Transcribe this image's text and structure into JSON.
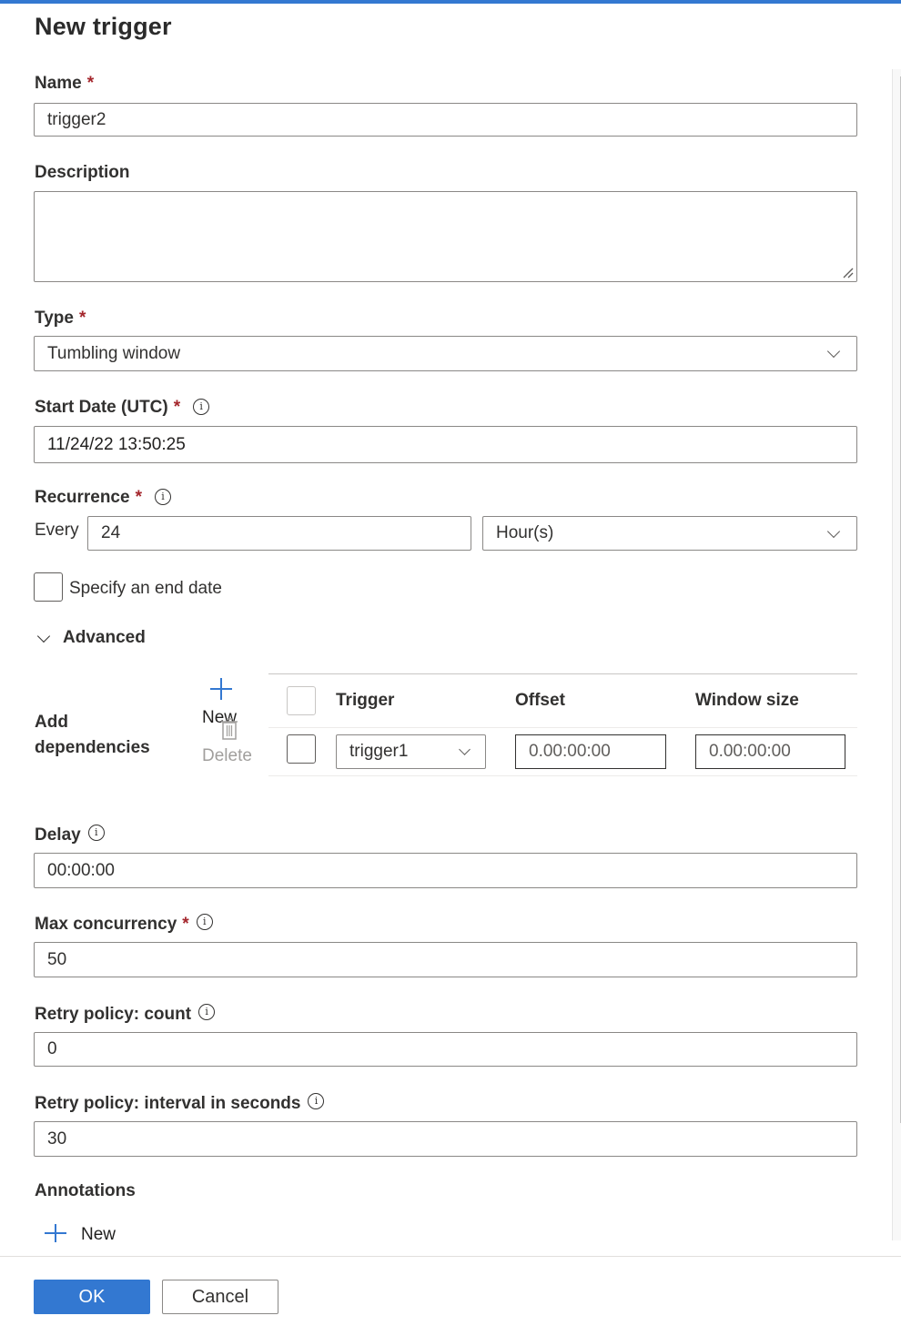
{
  "dialog": {
    "title": "New trigger"
  },
  "colors": {
    "accent": "#3378d1",
    "required": "#a4262c"
  },
  "fields": {
    "name": {
      "label": "Name",
      "required": "*",
      "value": "trigger2"
    },
    "description": {
      "label": "Description",
      "value": ""
    },
    "type": {
      "label": "Type",
      "required": "*",
      "value": "Tumbling window"
    },
    "start_date": {
      "label": "Start Date (UTC)",
      "required": "*",
      "value": "11/24/22 13:50:25",
      "info_icon": "info-icon"
    },
    "recurrence": {
      "label": "Recurrence",
      "required": "*",
      "every_label": "Every",
      "interval": "24",
      "unit": "Hour(s)",
      "info_icon": "info-icon"
    },
    "end_date": {
      "label": "Specify an end date",
      "checked": false
    },
    "advanced": {
      "label": "Advanced",
      "expanded": true
    },
    "dependencies": {
      "label_line1": "Add",
      "label_line2": "dependencies",
      "new_label": "New",
      "delete_label": "Delete",
      "columns": [
        "Trigger",
        "Offset",
        "Window size"
      ],
      "rows": [
        {
          "trigger": "trigger1",
          "offset": "0.00:00:00",
          "window_size": "0.00:00:00",
          "checked": false
        }
      ]
    },
    "delay": {
      "label": "Delay",
      "value": "00:00:00",
      "info_icon": "info-icon"
    },
    "max_concurrency": {
      "label": "Max concurrency",
      "required": "*",
      "value": "50",
      "info_icon": "info-icon"
    },
    "retry_count": {
      "label": "Retry policy: count",
      "value": "0",
      "info_icon": "info-icon"
    },
    "retry_interval": {
      "label": "Retry policy: interval in seconds",
      "value": "30",
      "info_icon": "info-icon"
    },
    "annotations": {
      "label": "Annotations",
      "new_label": "New"
    }
  },
  "footer": {
    "ok_label": "OK",
    "cancel_label": "Cancel"
  },
  "info_glyph": "i"
}
